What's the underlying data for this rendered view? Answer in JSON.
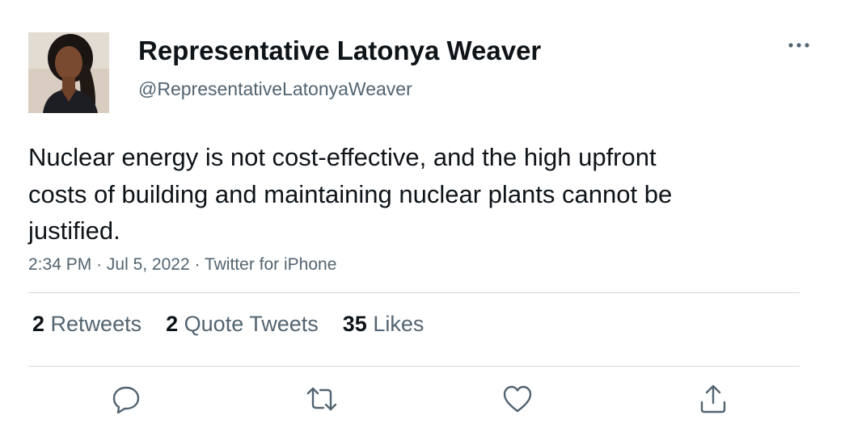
{
  "author": {
    "display_name": "Representative Latonya Weaver",
    "handle": "@RepresentativeLatonyaWeaver"
  },
  "tweet": {
    "text": "Nuclear energy is not cost-effective, and the high upfront costs of building and maintaining nuclear plants cannot be justified.",
    "time": "2:34 PM",
    "date": "Jul 5, 2022",
    "source": "Twitter for iPhone",
    "separator": "·"
  },
  "stats": {
    "retweets": {
      "count": "2",
      "label": "Retweets"
    },
    "quote_tweets": {
      "count": "2",
      "label": "Quote Tweets"
    },
    "likes": {
      "count": "35",
      "label": "Likes"
    }
  },
  "colors": {
    "text": "#0f1419",
    "secondary": "#536471",
    "divider": "#cfd9de"
  },
  "icons": [
    "more-icon",
    "reply-icon",
    "retweet-icon",
    "like-icon",
    "share-icon"
  ]
}
